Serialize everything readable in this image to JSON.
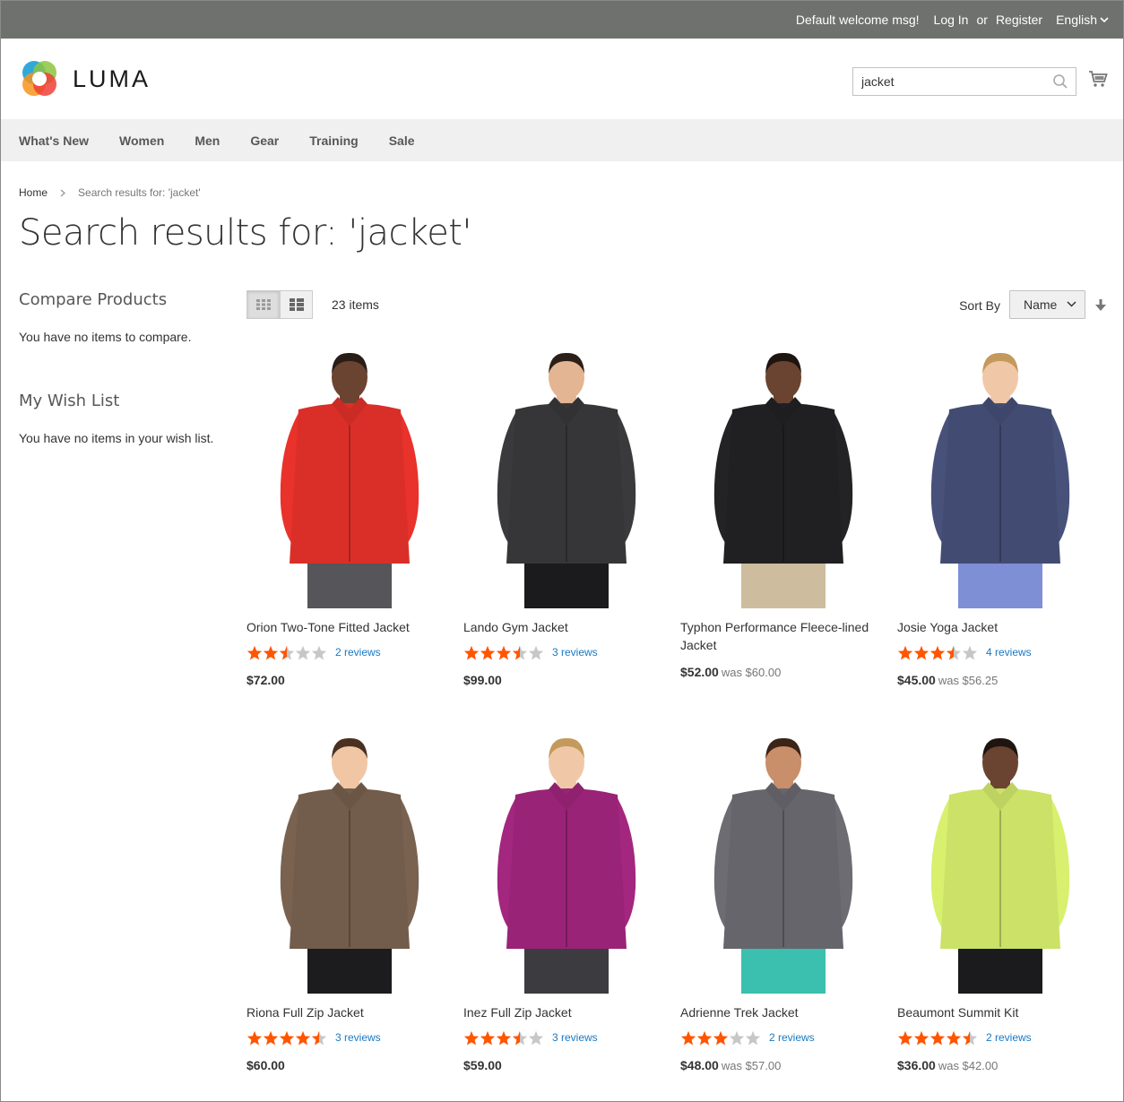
{
  "topbar": {
    "welcome": "Default welcome msg!",
    "login": "Log In",
    "or": "or",
    "register": "Register",
    "language": "English"
  },
  "header": {
    "logo_text": "LUMA",
    "search_value": "jacket"
  },
  "nav": [
    "What's New",
    "Women",
    "Men",
    "Gear",
    "Training",
    "Sale"
  ],
  "breadcrumb": {
    "home": "Home",
    "current": "Search results for: 'jacket'"
  },
  "page_title": "Search results for: 'jacket'",
  "sidebar": {
    "compare_title": "Compare Products",
    "compare_empty": "You have no items to compare.",
    "wishlist_title": "My Wish List",
    "wishlist_empty": "You have no items in your wish list."
  },
  "toolbar": {
    "amount": "23 items",
    "sort_label": "Sort By",
    "sort_value": "Name"
  },
  "colors": {
    "star_filled": "#ff5501",
    "star_empty": "#c7c7c7",
    "link": "#1979c3",
    "topbar_bg": "#6e716e",
    "nav_bg": "#f0f0f0"
  },
  "products": [
    {
      "name": "Orion Two-Tone Fitted Jacket",
      "rating": 2.5,
      "reviews": "2 reviews",
      "price": "$72.00",
      "was": "",
      "garment": "#e8322b",
      "pants": "#55555a",
      "skin": "#6b4431",
      "hair": "#2a1c16"
    },
    {
      "name": "Lando Gym Jacket",
      "rating": 3.5,
      "reviews": "3 reviews",
      "price": "$99.00",
      "was": "",
      "garment": "#3a3a3c",
      "pants": "#1b1b1d",
      "skin": "#e4b592",
      "hair": "#2c1f18"
    },
    {
      "name": "Typhon Performance Fleece-lined Jacket",
      "rating": null,
      "reviews": "",
      "price": "$52.00",
      "was": "was $60.00",
      "garment": "#232325",
      "pants": "#cdbd9e",
      "skin": "#6b4431",
      "hair": "#1f1510"
    },
    {
      "name": "Josie Yoga Jacket",
      "rating": 3.5,
      "reviews": "4 reviews",
      "price": "$45.00",
      "was": "was $56.25",
      "garment": "#47517a",
      "pants": "#7e8fd6",
      "skin": "#f0c8a8",
      "hair": "#c49a5c"
    },
    {
      "name": "Riona Full Zip Jacket",
      "rating": 4.5,
      "reviews": "3 reviews",
      "price": "$60.00",
      "was": "",
      "garment": "#7a6250",
      "pants": "#1c1c1e",
      "skin": "#f1c6a4",
      "hair": "#4a3020"
    },
    {
      "name": "Inez Full Zip Jacket",
      "rating": 3.5,
      "reviews": "3 reviews",
      "price": "$59.00",
      "was": "",
      "garment": "#a3267f",
      "pants": "#3c3c40",
      "skin": "#f0c8a8",
      "hair": "#c49a5c"
    },
    {
      "name": "Adrienne Trek Jacket",
      "rating": 3,
      "reviews": "2 reviews",
      "price": "$48.00",
      "was": "was $57.00",
      "garment": "#6c6c72",
      "pants": "#3bbfae",
      "skin": "#c98e6a",
      "hair": "#3b2418"
    },
    {
      "name": "Beaumont Summit Kit",
      "rating": 4.5,
      "reviews": "2 reviews",
      "price": "$36.00",
      "was": "was $42.00",
      "garment": "#d8f06e",
      "pants": "#1b1b1d",
      "skin": "#6b4431",
      "hair": "#1f1510"
    }
  ]
}
